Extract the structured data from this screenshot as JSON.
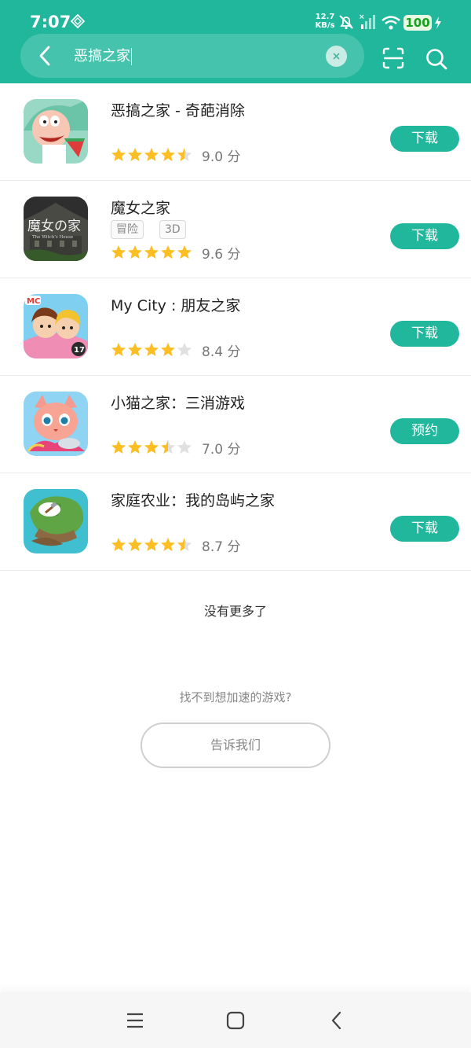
{
  "status_bar": {
    "time": "7:07",
    "net_speed_value": "12.7",
    "net_speed_unit": "KB/s",
    "battery": "100",
    "icons": [
      "gem-icon",
      "bell-muted-icon",
      "signal-icon",
      "wifi-icon",
      "battery-icon",
      "charging-icon"
    ]
  },
  "search": {
    "query": "恶搞之家",
    "back_icon": "back-arrow-icon",
    "clear_icon": "clear-icon",
    "scan_icon": "scan-icon",
    "search_icon": "search-icon"
  },
  "results": [
    {
      "name": "恶搞之家 - 奇葩消除",
      "tags": [],
      "rating": 4.5,
      "score": "9.0 分",
      "action": "下载"
    },
    {
      "name": "魔女之家",
      "tags": [
        "冒险",
        "3D"
      ],
      "rating": 5,
      "score": "9.6 分",
      "action": "下载"
    },
    {
      "name": "My City : 朋友之家",
      "tags": [],
      "rating": 4,
      "score": "8.4 分",
      "action": "下载"
    },
    {
      "name": "小猫之家：三消游戏",
      "tags": [],
      "rating": 3.5,
      "score": "7.0 分",
      "action": "预约"
    },
    {
      "name": "家庭农业：我的岛屿之家",
      "tags": [],
      "rating": 4.5,
      "score": "8.7 分",
      "action": "下载"
    }
  ],
  "footer": {
    "no_more": "没有更多了",
    "cant_find": "找不到想加速的游戏?",
    "tell_us": "告诉我们"
  },
  "nav": {
    "icons": [
      "menu-icon",
      "home-icon",
      "back-icon"
    ]
  },
  "colors": {
    "accent": "#21b79c",
    "star": "#fbbf24",
    "star_empty": "#e0e0e0"
  }
}
